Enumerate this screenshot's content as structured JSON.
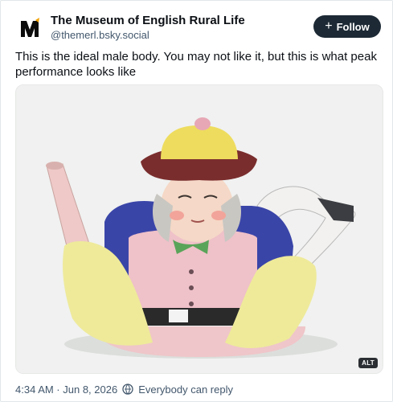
{
  "post": {
    "author_name": "The Museum of English Rural Life",
    "author_handle": "@themerl.bsky.social",
    "follow_label": "Follow",
    "text": "This is the ideal male body. You may not like it, but this is what peak performance looks like",
    "image_alt_badge": "ALT",
    "timestamp": "4:34 AM · Jun 8, 2026",
    "reply_setting": "Everybody can reply"
  },
  "icons": {
    "logo": "museum-m-logo",
    "follow": "plus-icon",
    "reply": "globe-reply-icon"
  },
  "colors": {
    "follow_bg": "#1d2a35",
    "handle_text": "#42576c"
  }
}
